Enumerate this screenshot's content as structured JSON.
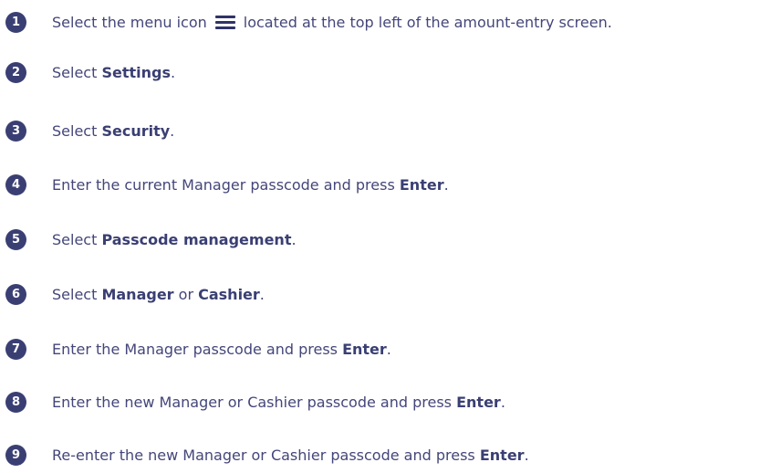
{
  "steps": [
    {
      "number": "1",
      "before": "Select the menu icon",
      "icon": "hamburger-menu-icon",
      "after": "located at the top left of the amount-entry screen."
    },
    {
      "number": "2",
      "prefix": "Select ",
      "strong": "Settings",
      "suffix": "."
    },
    {
      "number": "3",
      "prefix": "Select ",
      "strong": "Security",
      "suffix": "."
    },
    {
      "number": "4",
      "prefix": "Enter the current Manager passcode and press ",
      "strong": "Enter",
      "suffix": "."
    },
    {
      "number": "5",
      "prefix": "Select ",
      "strong": "Passcode management",
      "suffix": "."
    },
    {
      "number": "6",
      "prefix": "Select ",
      "strong": "Manager",
      "middle": " or ",
      "strong2": "Cashier",
      "suffix": "."
    },
    {
      "number": "7",
      "prefix": "Enter the Manager passcode and press ",
      "strong": "Enter",
      "suffix": "."
    },
    {
      "number": "8",
      "prefix": "Enter the new Manager or Cashier passcode and press ",
      "strong": "Enter",
      "suffix": "."
    },
    {
      "number": "9",
      "prefix": "Re-enter the new Manager or Cashier passcode and press ",
      "strong": "Enter",
      "suffix": "."
    }
  ],
  "colors": {
    "badge": "#3a3f73",
    "text": "#44467a"
  }
}
